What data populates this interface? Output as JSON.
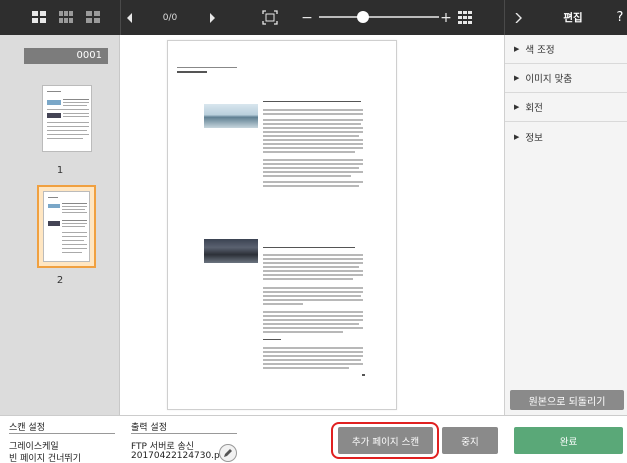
{
  "toolbar": {
    "page_counter": "0/0",
    "side_title": "편집",
    "help_glyph": "?",
    "zoom_out": "−",
    "zoom_in": "+",
    "zoom_level": 0.35
  },
  "thumbnails": {
    "page_field_value": "0001",
    "pages": [
      {
        "label": "1",
        "selected": false
      },
      {
        "label": "2",
        "selected": true
      }
    ]
  },
  "side_panel": {
    "items": [
      {
        "label": "색 조정"
      },
      {
        "label": "이미지 맞춤"
      },
      {
        "label": "회전"
      },
      {
        "label": "정보"
      }
    ],
    "revert_label": "원본으로 되돌리기"
  },
  "footer": {
    "scan_settings_title": "스캔 설정",
    "scan_settings_line1": "그레이스케일",
    "scan_settings_line2": "빈 페이지 건너뛰기",
    "output_settings_title": "출력 설정",
    "output_settings_line1": "FTP 서버로 송신",
    "output_settings_line2": "20170422124730.p...",
    "add_page_scan_label": "추가 페이지 스캔",
    "stop_label": "중지",
    "finish_label": "완료"
  },
  "colors": {
    "toolbar_bg": "#2e2e2e",
    "accent_orange": "#f0a040",
    "finish_green": "#5aa878",
    "button_gray": "#8a8a8a",
    "highlight_red": "#e02020"
  },
  "icons": [
    "thumbnail-grid-large-icon",
    "thumbnail-grid-medium-icon",
    "thumbnail-grid-small-icon",
    "prev-page-icon",
    "next-page-icon",
    "fit-page-icon",
    "zoom-out-icon",
    "zoom-in-icon",
    "multi-grid-icon",
    "collapse-panel-icon",
    "help-icon",
    "pencil-icon",
    "expand-arrow-icon"
  ]
}
